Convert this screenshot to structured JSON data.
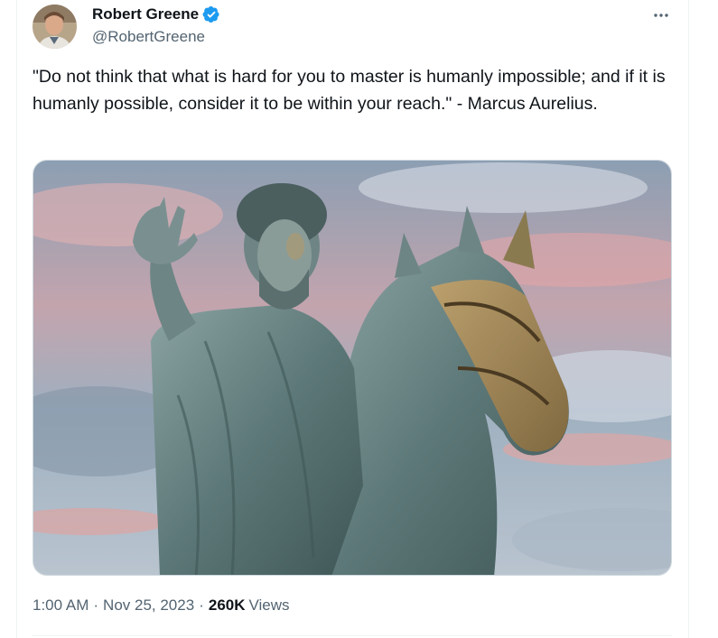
{
  "author": {
    "display_name": "Robert Greene",
    "handle": "@RobertGreene",
    "verified": true,
    "avatar_icon": "profile-photo"
  },
  "tweet": {
    "text": "\"Do not think that what is hard for you to master is humanly impossible; and if it is humanly possible, consider it to be within your reach.\" - Marcus Aurelius.",
    "more_icon": "more-options-icon"
  },
  "media": {
    "alt": "Equestrian statue of Marcus Aurelius against a pink and blue cloudy sky",
    "colors": {
      "sky_blue": "#8fa5b8",
      "sky_pink": "#e4a3a8",
      "bronze": "#6f8a8c",
      "gold": "#b89558"
    }
  },
  "meta": {
    "time": "1:00 AM",
    "separator": "·",
    "date": "Nov 25, 2023",
    "views_count": "260K",
    "views_label": "Views"
  },
  "colors": {
    "text": "#0f1419",
    "secondary": "#536471",
    "verified_blue": "#1d9bf0",
    "border": "#cfd9de"
  }
}
